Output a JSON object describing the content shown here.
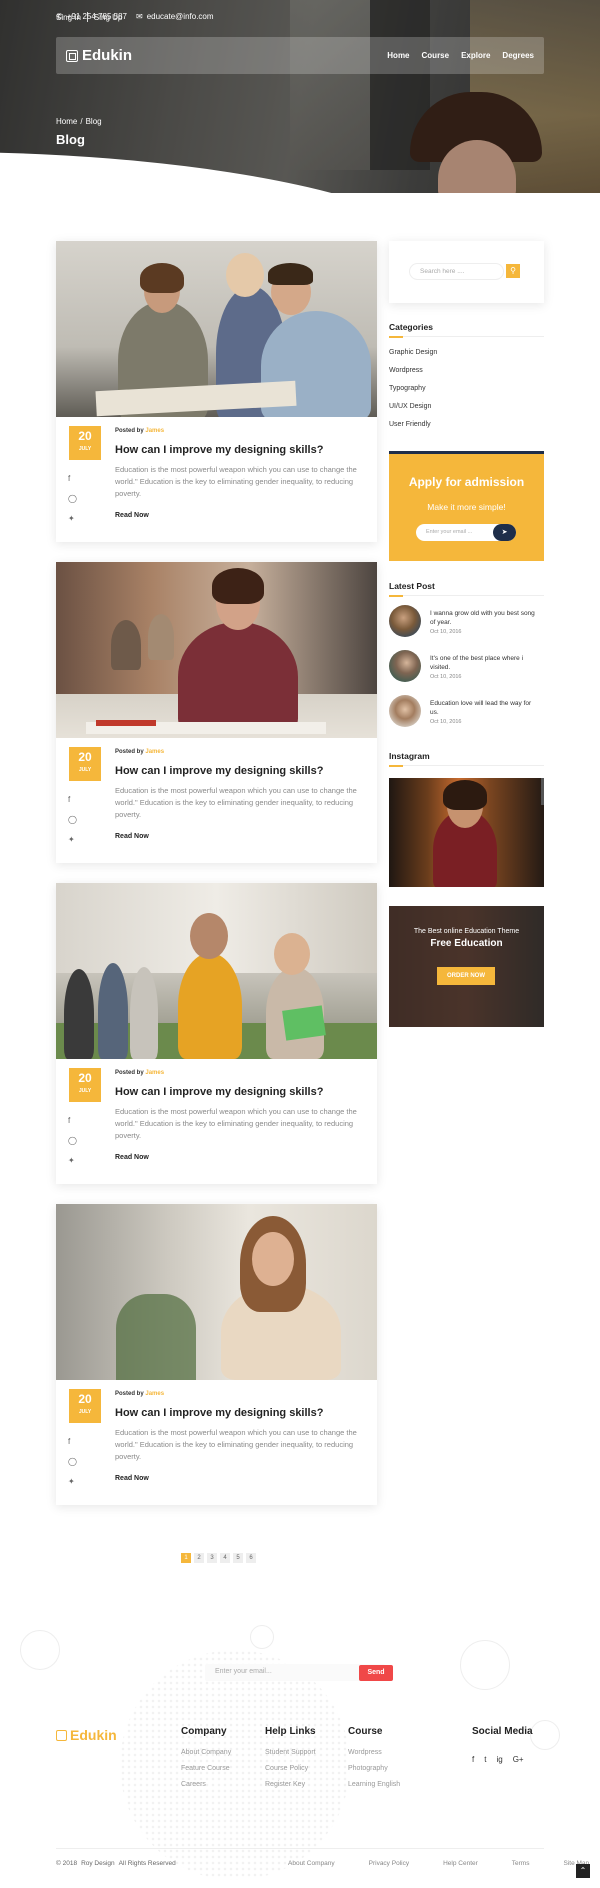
{
  "topbar": {
    "phone": "+91 254 785 587",
    "email": "educate@info.com",
    "sign_in": "Sing In",
    "sign_up": "Sing Up"
  },
  "brand": {
    "name": "Edukin"
  },
  "nav": {
    "items": [
      "Home",
      "Course",
      "Explore",
      "Degrees"
    ]
  },
  "breadcrumb": {
    "home": "Home",
    "separator": "/",
    "current": "Blog"
  },
  "page_title": "Blog",
  "posts": [
    {
      "day": "20",
      "month": "JULY",
      "posted_by_label": "Posted by",
      "author": "James",
      "title": "How can I improve my designing skills?",
      "excerpt": "Education is the most powerful weapon which you can use to change the world.\" Education is the key to eliminating gender inequality, to reducing poverty.",
      "read_more": "Read Now"
    },
    {
      "day": "20",
      "month": "JULY",
      "posted_by_label": "Posted by",
      "author": "James",
      "title": "How can I improve my designing skills?",
      "excerpt": "Education is the most powerful weapon which you can use to change the world.\" Education is the key to eliminating gender inequality, to reducing poverty.",
      "read_more": "Read Now"
    },
    {
      "day": "20",
      "month": "JULY",
      "posted_by_label": "Posted by",
      "author": "James",
      "title": "How can I improve my designing skills?",
      "excerpt": "Education is the most powerful weapon which you can use to change the world.\" Education is the key to eliminating gender inequality, to reducing poverty.",
      "read_more": "Read Now"
    },
    {
      "day": "20",
      "month": "JULY",
      "posted_by_label": "Posted by",
      "author": "James",
      "title": "How can I improve my designing skills?",
      "excerpt": "Education is the most powerful weapon which you can use to change the world.\" Education is the key to eliminating gender inequality, to reducing poverty.",
      "read_more": "Read Now"
    }
  ],
  "post_social_icons": [
    "facebook-icon",
    "instagram-icon",
    "twitter-icon"
  ],
  "sidebar": {
    "search_placeholder": "Search here ....",
    "categories_title": "Categories",
    "categories": [
      "Graphic Design",
      "Wordpress",
      "Typography",
      "UI/UX Design",
      "User Friendly"
    ],
    "apply": {
      "title": "Apply for admission",
      "subtitle": "Make it more simple!",
      "email_placeholder": "Enter your email ..."
    },
    "latest_title": "Latest Post",
    "latest_posts": [
      {
        "title": "I wanna grow old with you best song of year.",
        "date": "Oct 10, 2016"
      },
      {
        "title": "It's one of the best place where i visited.",
        "date": "Oct 10, 2016"
      },
      {
        "title": "Education love will lead the way for us.",
        "date": "Oct 10, 2016"
      }
    ],
    "instagram_title": "Instagram",
    "promo": {
      "subtitle": "The Best online Education Theme",
      "title": "Free Education",
      "button": "ORDER NOW"
    }
  },
  "pagination": {
    "pages": [
      "1",
      "2",
      "3",
      "4",
      "5",
      "6"
    ],
    "active": "1"
  },
  "footer": {
    "newsletter_placeholder": "Enter your email...",
    "send": "Send",
    "brand": "Edukin",
    "columns": [
      {
        "title": "Company",
        "items": [
          "About Company",
          "Feature Course",
          "Careers"
        ]
      },
      {
        "title": "Help Links",
        "items": [
          "Student Support",
          "Course Policy",
          "Register Key"
        ]
      },
      {
        "title": "Course",
        "items": [
          "Wordpress",
          "Photography",
          "Learning English"
        ]
      }
    ],
    "social_title": "Social Media",
    "social_icons": [
      "f",
      "t",
      "ig",
      "G+"
    ],
    "copyright": "© 2018",
    "designer": "Roy Design",
    "rights": "All Rights Reserved",
    "bottom_links": [
      "About Company",
      "Privacy Policy",
      "Help Center",
      "Terms",
      "Site Map"
    ]
  },
  "colors": {
    "accent": "#f5b73b",
    "navy": "#1e2e4a",
    "send": "#f04848"
  }
}
